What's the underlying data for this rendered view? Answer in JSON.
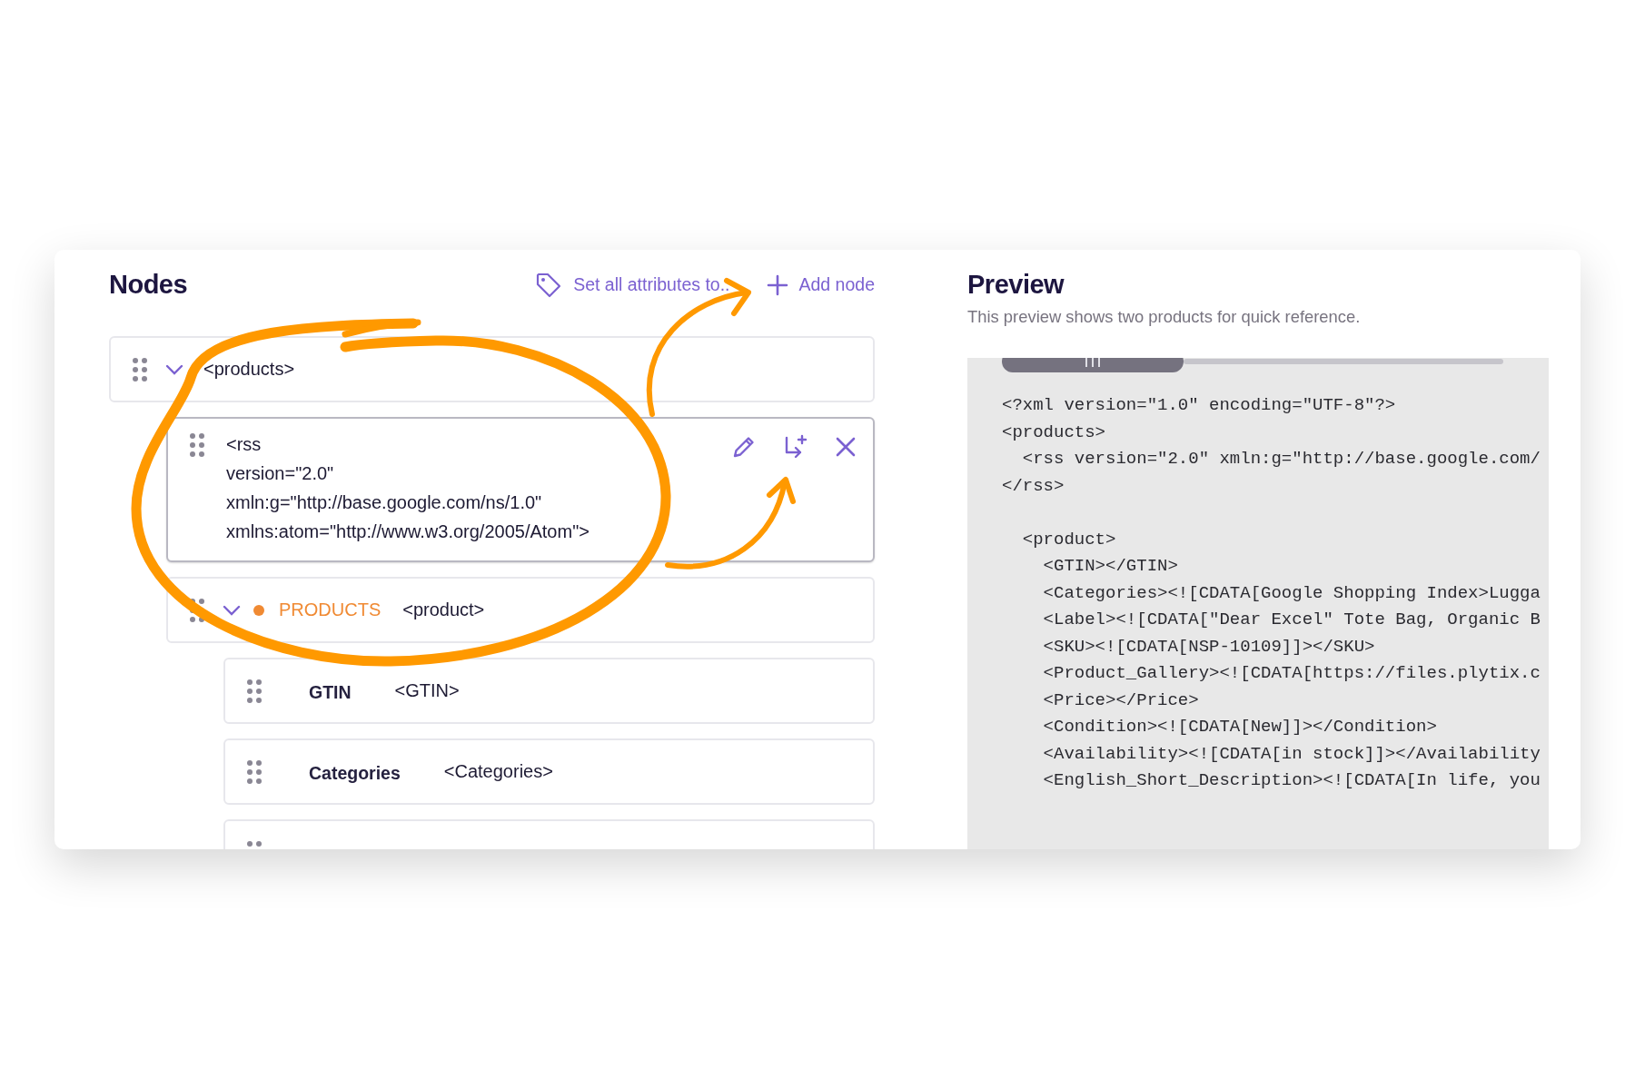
{
  "nodes_panel": {
    "title": "Nodes",
    "actions": [
      {
        "kind": "tag",
        "label": "Set all attributes to.."
      },
      {
        "kind": "add",
        "label": "Add node"
      }
    ],
    "nodes": [
      {
        "kind": "element",
        "tag": "<products>",
        "expanded": true,
        "children": [
          {
            "kind": "block",
            "lines": [
              "<rss",
              "version=\"2.0\"",
              "xmln:g=\"http://base.google.com/ns/1.0\"",
              "xmlns:atom=\"http://www.w3.org/2005/Atom\">"
            ],
            "actions": [
              {
                "kind": "edit"
              },
              {
                "kind": "add-child"
              },
              {
                "kind": "delete"
              }
            ]
          },
          {
            "kind": "group",
            "name": "PRODUCTS",
            "color": "#f08a33",
            "tag": "<product>",
            "expanded": true,
            "children": [
              {
                "kind": "field",
                "name": "GTIN",
                "tag": "<GTIN>"
              },
              {
                "kind": "field",
                "name": "Categories",
                "tag": "<Categories>"
              },
              {
                "kind": "field"
              }
            ]
          }
        ]
      }
    ]
  },
  "preview": {
    "title": "Preview",
    "subtitle": "This preview shows two products for quick reference.",
    "lines": [
      {
        "text": "<?xml version=\"1.0\" encoding=\"UTF-8\"?>"
      },
      {
        "text": "<products>"
      },
      {
        "text": "  <rss version=\"2.0\" xmln:g=\"http://base.google.com/"
      },
      {
        "text": "</rss>"
      },
      {
        "text": "  <product>",
        "gap_before": true
      },
      {
        "text": "    <GTIN></GTIN>"
      },
      {
        "text": "    <Categories><![CDATA[Google Shopping Index>Lugga"
      },
      {
        "text": "    <Label><![CDATA[\"Dear Excel\" Tote Bag, Organic B"
      },
      {
        "text": "    <SKU><![CDATA[NSP-10109]]></SKU>"
      },
      {
        "text": "    <Product_Gallery><![CDATA[https://files.plytix.c"
      },
      {
        "text": "    <Price></Price>"
      },
      {
        "text": "    <Condition><![CDATA[New]]></Condition>"
      },
      {
        "text": "    <Availability><![CDATA[in stock]]></Availability"
      },
      {
        "text": "    <English_Short_Description><![CDATA[In life, you"
      }
    ]
  }
}
